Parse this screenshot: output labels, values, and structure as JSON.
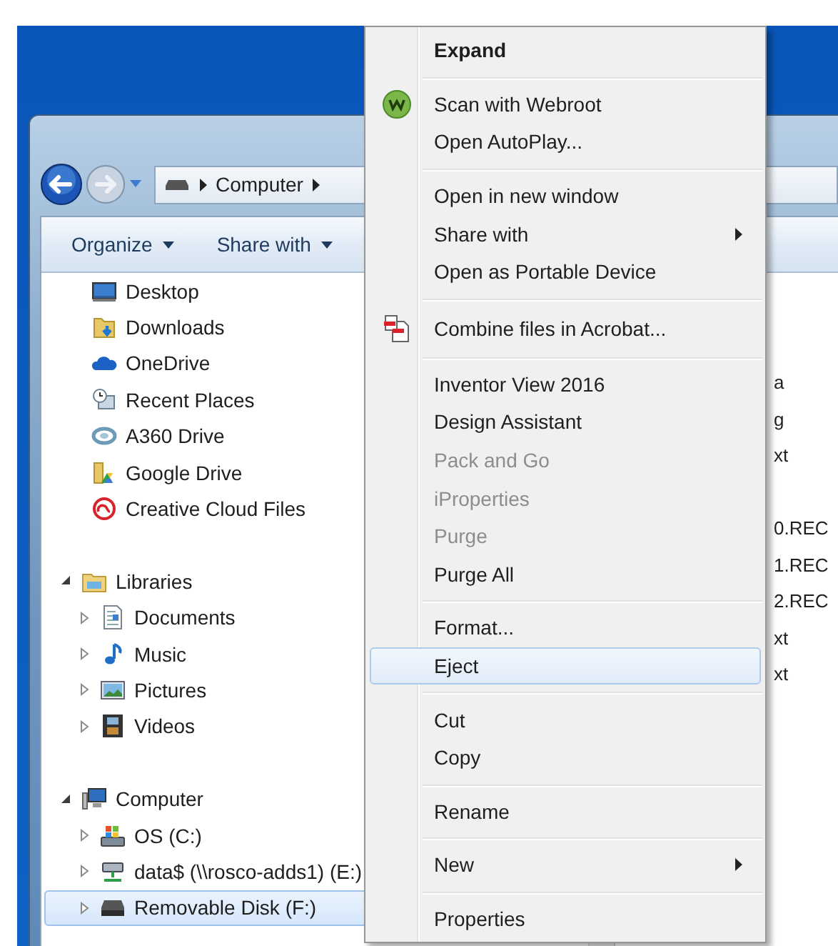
{
  "address_bar": {
    "segments": [
      "Computer"
    ]
  },
  "toolbar": [
    {
      "label": "Organize"
    },
    {
      "label": "Share with"
    }
  ],
  "navigation": {
    "favorites": [
      {
        "label": "Desktop",
        "kind": "desktop",
        "selected": false
      },
      {
        "label": "Downloads",
        "kind": "downloads",
        "selected": false
      },
      {
        "label": "OneDrive",
        "kind": "cloud",
        "selected": false
      },
      {
        "label": "Recent Places",
        "kind": "recent",
        "selected": false
      },
      {
        "label": "A360 Drive",
        "kind": "ring",
        "selected": false
      },
      {
        "label": "Google Drive",
        "kind": "gdrive",
        "selected": false
      },
      {
        "label": "Creative Cloud Files",
        "kind": "swirl",
        "selected": false
      }
    ],
    "tree": [
      {
        "label": "Libraries",
        "kind": "library",
        "expanded": true,
        "selected": false,
        "children": [
          {
            "label": "Documents",
            "kind": "documents",
            "expanded": false,
            "selected": false
          },
          {
            "label": "Music",
            "kind": "music",
            "expanded": false,
            "selected": false
          },
          {
            "label": "Pictures",
            "kind": "pictures",
            "expanded": false,
            "selected": false
          },
          {
            "label": "Videos",
            "kind": "videos",
            "expanded": false,
            "selected": false
          }
        ]
      },
      {
        "label": "Computer",
        "kind": "computer",
        "expanded": true,
        "selected": false,
        "children": [
          {
            "label": "OS (C:)",
            "kind": "osdrive",
            "expanded": false,
            "selected": false
          },
          {
            "label": "data$ (\\\\rosco-adds1) (E:)",
            "kind": "netdrive",
            "expanded": false,
            "selected": false
          },
          {
            "label": "Removable Disk (F:)",
            "kind": "removable",
            "expanded": false,
            "selected": true
          }
        ]
      }
    ]
  },
  "file_list": {
    "groups": [
      [
        "a",
        "g",
        "xt"
      ],
      [
        "0.REC",
        "1.REC",
        "2.REC",
        "xt",
        "xt"
      ]
    ]
  },
  "context_menu": {
    "groups": [
      [
        {
          "label": "Expand",
          "default": true,
          "disabled": false,
          "selected": false,
          "submenu": false
        }
      ],
      [
        {
          "label": "Scan with Webroot",
          "kind": "webroot",
          "default": false,
          "disabled": false,
          "selected": false,
          "submenu": false
        },
        {
          "label": "Open AutoPlay...",
          "default": false,
          "disabled": false,
          "selected": false,
          "submenu": false
        }
      ],
      [
        {
          "label": "Open in new window",
          "default": false,
          "disabled": false,
          "selected": false,
          "submenu": false
        },
        {
          "label": "Share with",
          "default": false,
          "disabled": false,
          "selected": false,
          "submenu": true
        },
        {
          "label": "Open as Portable Device",
          "default": false,
          "disabled": false,
          "selected": false,
          "submenu": false
        }
      ],
      [
        {
          "label": "Combine files in Acrobat...",
          "kind": "acrobat",
          "default": false,
          "disabled": false,
          "selected": false,
          "submenu": false
        }
      ],
      [
        {
          "label": "Inventor View 2016",
          "default": false,
          "disabled": false,
          "selected": false,
          "submenu": false
        },
        {
          "label": "Design Assistant",
          "default": false,
          "disabled": false,
          "selected": false,
          "submenu": false
        },
        {
          "label": "Pack and Go",
          "default": false,
          "disabled": true,
          "selected": false,
          "submenu": false
        },
        {
          "label": "iProperties",
          "default": false,
          "disabled": true,
          "selected": false,
          "submenu": false
        },
        {
          "label": "Purge",
          "default": false,
          "disabled": true,
          "selected": false,
          "submenu": false
        },
        {
          "label": "Purge All",
          "default": false,
          "disabled": false,
          "selected": false,
          "submenu": false
        }
      ],
      [
        {
          "label": "Format...",
          "default": false,
          "disabled": false,
          "selected": false,
          "submenu": false
        },
        {
          "label": "Eject",
          "default": false,
          "disabled": false,
          "selected": true,
          "submenu": false
        }
      ],
      [
        {
          "label": "Cut",
          "default": false,
          "disabled": false,
          "selected": false,
          "submenu": false
        },
        {
          "label": "Copy",
          "default": false,
          "disabled": false,
          "selected": false,
          "submenu": false
        }
      ],
      [
        {
          "label": "Rename",
          "default": false,
          "disabled": false,
          "selected": false,
          "submenu": false
        }
      ],
      [
        {
          "label": "New",
          "default": false,
          "disabled": false,
          "selected": false,
          "submenu": true
        }
      ],
      [
        {
          "label": "Properties",
          "default": false,
          "disabled": false,
          "selected": false,
          "submenu": false
        }
      ]
    ]
  }
}
